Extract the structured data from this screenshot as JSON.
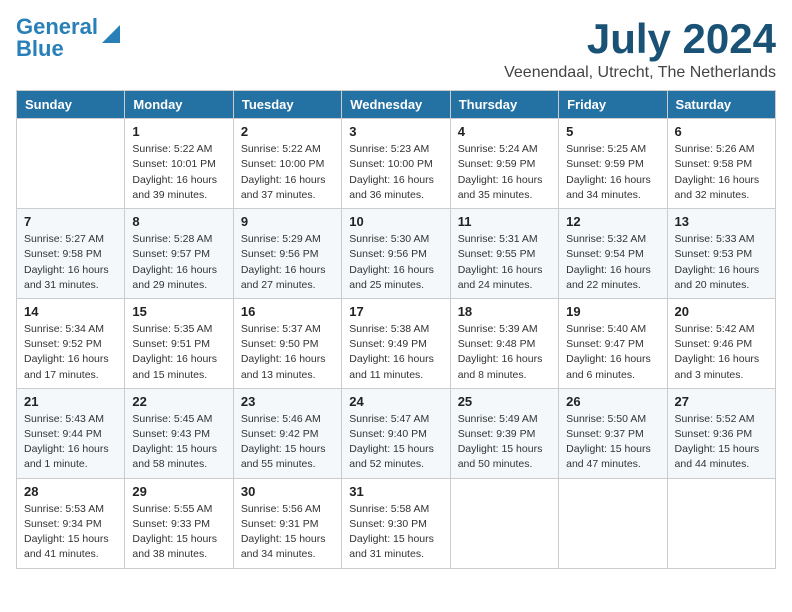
{
  "header": {
    "logo_line1": "General",
    "logo_line2": "Blue",
    "month": "July 2024",
    "location": "Veenendaal, Utrecht, The Netherlands"
  },
  "columns": [
    "Sunday",
    "Monday",
    "Tuesday",
    "Wednesday",
    "Thursday",
    "Friday",
    "Saturday"
  ],
  "weeks": [
    [
      {
        "day": "",
        "info": ""
      },
      {
        "day": "1",
        "info": "Sunrise: 5:22 AM\nSunset: 10:01 PM\nDaylight: 16 hours\nand 39 minutes."
      },
      {
        "day": "2",
        "info": "Sunrise: 5:22 AM\nSunset: 10:00 PM\nDaylight: 16 hours\nand 37 minutes."
      },
      {
        "day": "3",
        "info": "Sunrise: 5:23 AM\nSunset: 10:00 PM\nDaylight: 16 hours\nand 36 minutes."
      },
      {
        "day": "4",
        "info": "Sunrise: 5:24 AM\nSunset: 9:59 PM\nDaylight: 16 hours\nand 35 minutes."
      },
      {
        "day": "5",
        "info": "Sunrise: 5:25 AM\nSunset: 9:59 PM\nDaylight: 16 hours\nand 34 minutes."
      },
      {
        "day": "6",
        "info": "Sunrise: 5:26 AM\nSunset: 9:58 PM\nDaylight: 16 hours\nand 32 minutes."
      }
    ],
    [
      {
        "day": "7",
        "info": "Sunrise: 5:27 AM\nSunset: 9:58 PM\nDaylight: 16 hours\nand 31 minutes."
      },
      {
        "day": "8",
        "info": "Sunrise: 5:28 AM\nSunset: 9:57 PM\nDaylight: 16 hours\nand 29 minutes."
      },
      {
        "day": "9",
        "info": "Sunrise: 5:29 AM\nSunset: 9:56 PM\nDaylight: 16 hours\nand 27 minutes."
      },
      {
        "day": "10",
        "info": "Sunrise: 5:30 AM\nSunset: 9:56 PM\nDaylight: 16 hours\nand 25 minutes."
      },
      {
        "day": "11",
        "info": "Sunrise: 5:31 AM\nSunset: 9:55 PM\nDaylight: 16 hours\nand 24 minutes."
      },
      {
        "day": "12",
        "info": "Sunrise: 5:32 AM\nSunset: 9:54 PM\nDaylight: 16 hours\nand 22 minutes."
      },
      {
        "day": "13",
        "info": "Sunrise: 5:33 AM\nSunset: 9:53 PM\nDaylight: 16 hours\nand 20 minutes."
      }
    ],
    [
      {
        "day": "14",
        "info": "Sunrise: 5:34 AM\nSunset: 9:52 PM\nDaylight: 16 hours\nand 17 minutes."
      },
      {
        "day": "15",
        "info": "Sunrise: 5:35 AM\nSunset: 9:51 PM\nDaylight: 16 hours\nand 15 minutes."
      },
      {
        "day": "16",
        "info": "Sunrise: 5:37 AM\nSunset: 9:50 PM\nDaylight: 16 hours\nand 13 minutes."
      },
      {
        "day": "17",
        "info": "Sunrise: 5:38 AM\nSunset: 9:49 PM\nDaylight: 16 hours\nand 11 minutes."
      },
      {
        "day": "18",
        "info": "Sunrise: 5:39 AM\nSunset: 9:48 PM\nDaylight: 16 hours\nand 8 minutes."
      },
      {
        "day": "19",
        "info": "Sunrise: 5:40 AM\nSunset: 9:47 PM\nDaylight: 16 hours\nand 6 minutes."
      },
      {
        "day": "20",
        "info": "Sunrise: 5:42 AM\nSunset: 9:46 PM\nDaylight: 16 hours\nand 3 minutes."
      }
    ],
    [
      {
        "day": "21",
        "info": "Sunrise: 5:43 AM\nSunset: 9:44 PM\nDaylight: 16 hours\nand 1 minute."
      },
      {
        "day": "22",
        "info": "Sunrise: 5:45 AM\nSunset: 9:43 PM\nDaylight: 15 hours\nand 58 minutes."
      },
      {
        "day": "23",
        "info": "Sunrise: 5:46 AM\nSunset: 9:42 PM\nDaylight: 15 hours\nand 55 minutes."
      },
      {
        "day": "24",
        "info": "Sunrise: 5:47 AM\nSunset: 9:40 PM\nDaylight: 15 hours\nand 52 minutes."
      },
      {
        "day": "25",
        "info": "Sunrise: 5:49 AM\nSunset: 9:39 PM\nDaylight: 15 hours\nand 50 minutes."
      },
      {
        "day": "26",
        "info": "Sunrise: 5:50 AM\nSunset: 9:37 PM\nDaylight: 15 hours\nand 47 minutes."
      },
      {
        "day": "27",
        "info": "Sunrise: 5:52 AM\nSunset: 9:36 PM\nDaylight: 15 hours\nand 44 minutes."
      }
    ],
    [
      {
        "day": "28",
        "info": "Sunrise: 5:53 AM\nSunset: 9:34 PM\nDaylight: 15 hours\nand 41 minutes."
      },
      {
        "day": "29",
        "info": "Sunrise: 5:55 AM\nSunset: 9:33 PM\nDaylight: 15 hours\nand 38 minutes."
      },
      {
        "day": "30",
        "info": "Sunrise: 5:56 AM\nSunset: 9:31 PM\nDaylight: 15 hours\nand 34 minutes."
      },
      {
        "day": "31",
        "info": "Sunrise: 5:58 AM\nSunset: 9:30 PM\nDaylight: 15 hours\nand 31 minutes."
      },
      {
        "day": "",
        "info": ""
      },
      {
        "day": "",
        "info": ""
      },
      {
        "day": "",
        "info": ""
      }
    ]
  ]
}
